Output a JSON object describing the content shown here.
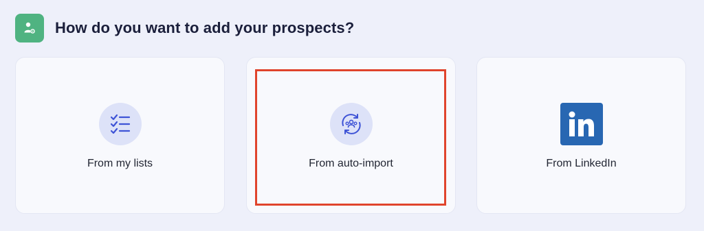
{
  "header": {
    "title": "How do you want to add your prospects?",
    "icon": "user-gear-icon",
    "icon_color": "#4fb381"
  },
  "options": [
    {
      "label": "From my lists",
      "icon": "checklist-icon"
    },
    {
      "label": "From auto-import",
      "icon": "sync-people-icon"
    },
    {
      "label": "From LinkedIn",
      "icon": "linkedin-icon"
    }
  ],
  "colors": {
    "background": "#eef0fa",
    "card_background": "#f8f9fd",
    "icon_circle": "#dde2f8",
    "icon_stroke": "#3e53d6",
    "linkedin_blue": "#2867b2",
    "highlight": "#e0442c"
  }
}
